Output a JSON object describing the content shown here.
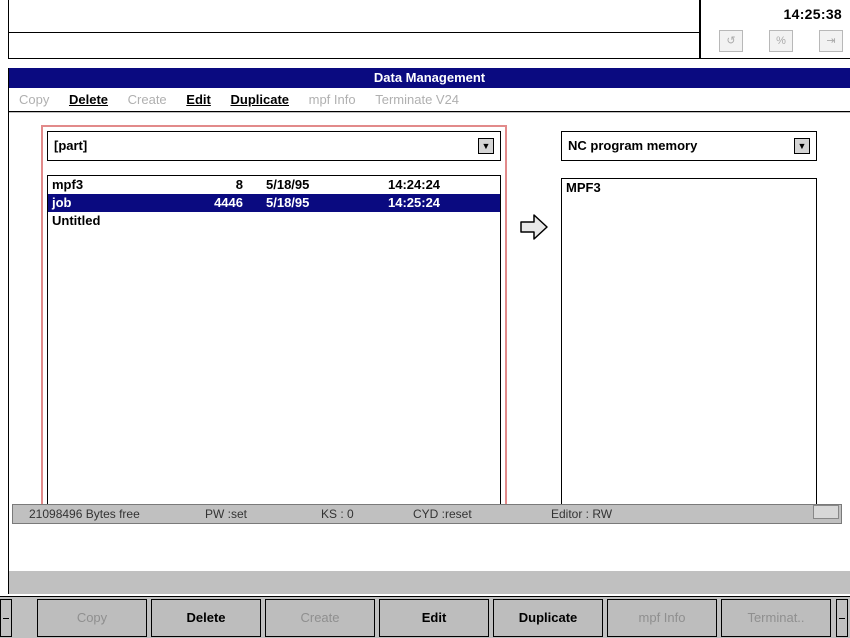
{
  "header": {
    "clock": "14:25:38",
    "icons": [
      "enter-icon",
      "percent-icon",
      "exit-icon"
    ]
  },
  "window": {
    "title": "Data Management",
    "menu": [
      {
        "label": "Copy",
        "enabled": false
      },
      {
        "label": "Delete",
        "enabled": true
      },
      {
        "label": "Create",
        "enabled": false
      },
      {
        "label": "Edit",
        "enabled": true
      },
      {
        "label": "Duplicate",
        "enabled": true
      },
      {
        "label": "mpf Info",
        "enabled": false
      },
      {
        "label": "Terminate V24",
        "enabled": false
      }
    ]
  },
  "left_panel": {
    "dropdown_value": "[part]",
    "files": [
      {
        "name": "mpf3",
        "size": "8",
        "date": "5/18/95",
        "time": "14:24:24",
        "selected": false
      },
      {
        "name": "job",
        "size": "4446",
        "date": "5/18/95",
        "time": "14:25:24",
        "selected": true
      },
      {
        "name": "Untitled",
        "size": "",
        "date": "",
        "time": "",
        "selected": false
      }
    ]
  },
  "right_panel": {
    "dropdown_value": "NC program memory",
    "items": [
      "MPF3"
    ]
  },
  "status": {
    "bytes_free": "21098496 Bytes free",
    "pw": "PW :set",
    "ks": "KS : 0",
    "cyd": "CYD :reset",
    "editor": "Editor : RW"
  },
  "softkeys": [
    {
      "label": "Copy",
      "enabled": false
    },
    {
      "label": "Delete",
      "enabled": true
    },
    {
      "label": "Create",
      "enabled": false
    },
    {
      "label": "Edit",
      "enabled": true
    },
    {
      "label": "Duplicate",
      "enabled": true
    },
    {
      "label": "mpf Info",
      "enabled": false
    },
    {
      "label": "Terminat..",
      "enabled": false
    }
  ],
  "colors": {
    "title_bar": "#0a0a80",
    "selection": "#0a0a80",
    "focus_frame": "#e28a8a",
    "disabled_text": "#b0b0b0"
  }
}
